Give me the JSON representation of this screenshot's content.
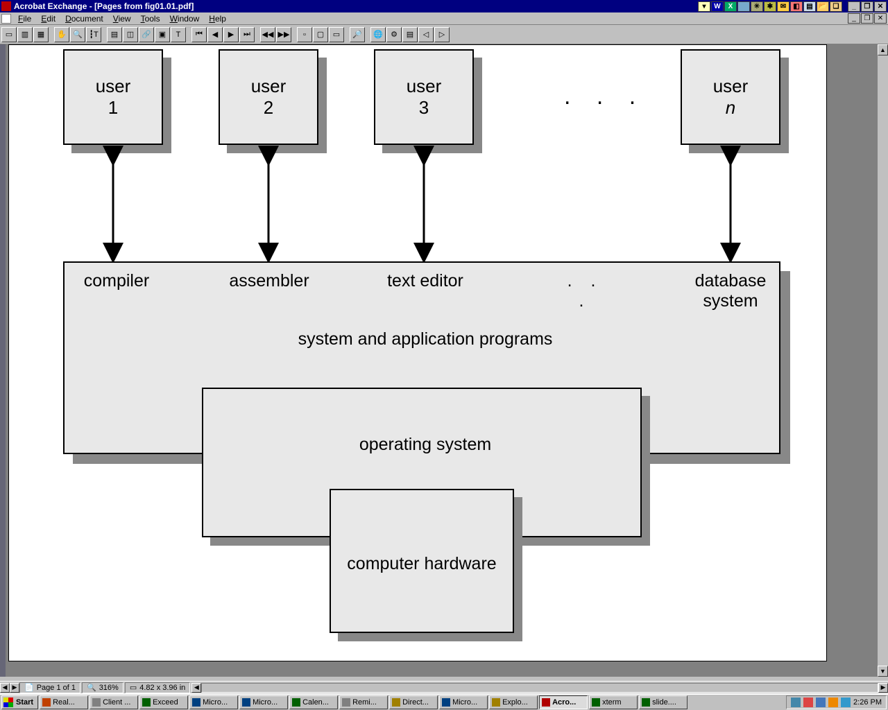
{
  "window": {
    "title": "Acrobat Exchange - [Pages from fig01.01.pdf]"
  },
  "menu": [
    "File",
    "Edit",
    "Document",
    "View",
    "Tools",
    "Window",
    "Help"
  ],
  "diagram": {
    "users": [
      {
        "top_label": "user",
        "sub": "1"
      },
      {
        "top_label": "user",
        "sub": "2"
      },
      {
        "top_label": "user",
        "sub": "3"
      },
      {
        "top_label": "user",
        "sub": "n",
        "italic": true
      }
    ],
    "dots_users": ". . .",
    "programs": {
      "labels": [
        "compiler",
        "assembler",
        "text editor",
        ". . .",
        "database\nsystem"
      ],
      "title": "system and application programs"
    },
    "os_label": "operating system",
    "hw_label": "computer hardware"
  },
  "status": {
    "page": "Page 1 of 1",
    "zoom": "316%",
    "dims": "4.82 x 3.96 in"
  },
  "taskbar": {
    "start": "Start",
    "items": [
      {
        "label": "Real...",
        "color": "#c04000"
      },
      {
        "label": "Client ...",
        "color": "#808080"
      },
      {
        "label": "Exceed",
        "color": "#006000"
      },
      {
        "label": "Micro...",
        "color": "#004080"
      },
      {
        "label": "Micro...",
        "color": "#004080"
      },
      {
        "label": "Calen...",
        "color": "#006000"
      },
      {
        "label": "Remi...",
        "color": "#808080"
      },
      {
        "label": "Direct...",
        "color": "#a08000"
      },
      {
        "label": "Micro...",
        "color": "#004080"
      },
      {
        "label": "Explo...",
        "color": "#a08000"
      },
      {
        "label": "Acro...",
        "color": "#b00000",
        "active": true
      },
      {
        "label": "xterm",
        "color": "#006000"
      },
      {
        "label": "slide....",
        "color": "#006000"
      }
    ],
    "clock": "2:26 PM"
  }
}
